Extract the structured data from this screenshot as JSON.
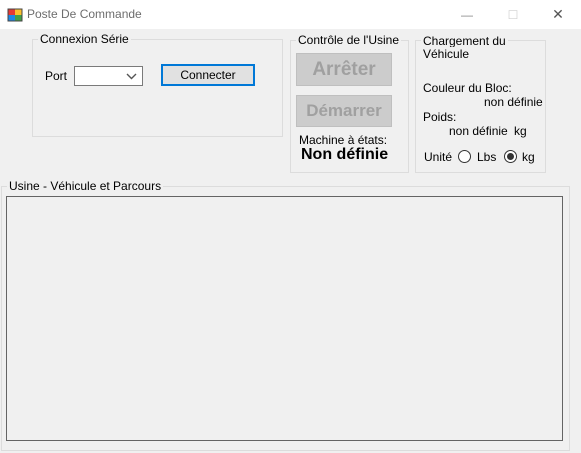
{
  "window": {
    "title": "Poste De Commande",
    "controls": {
      "minimize": "—",
      "maximize": "☐",
      "close": "✕"
    }
  },
  "connexion": {
    "group_label": "Connexion Série",
    "port_label": "Port",
    "port_value": "",
    "connect_label": "Connecter"
  },
  "controle": {
    "group_label": "Contrôle de l'Usine",
    "stop_label": "Arrêter",
    "start_label": "Démarrer",
    "state_label": "Machine à états:",
    "state_value": "Non définie"
  },
  "chargement": {
    "group_label_line1": "Chargement du",
    "group_label_line2": "Véhicule",
    "color_label": "Couleur du Bloc:",
    "color_value": "non définie",
    "weight_label": "Poids:",
    "weight_value": "non définie",
    "weight_unit": "kg",
    "unit_label": "Unité",
    "unit_options": [
      "Lbs",
      "kg"
    ],
    "unit_selected": "kg"
  },
  "usine": {
    "group_label": "Usine - Véhicule et Parcours"
  }
}
